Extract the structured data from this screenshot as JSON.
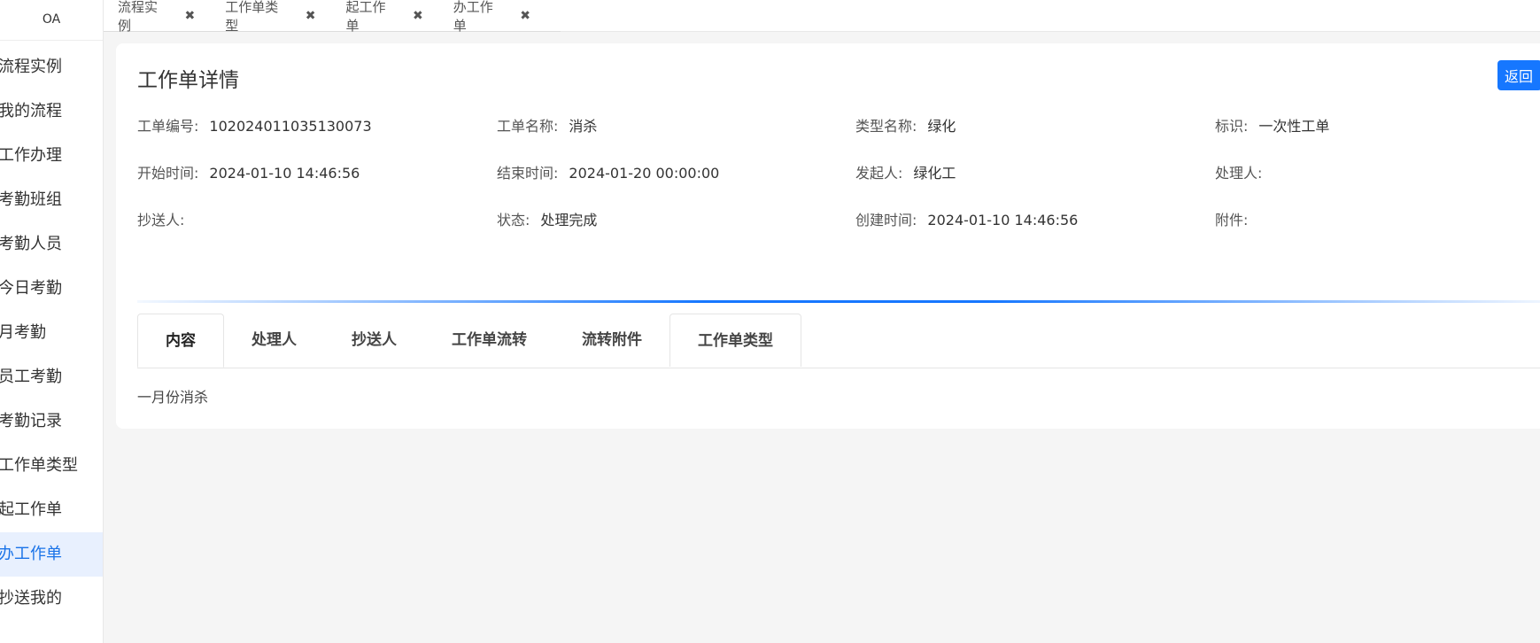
{
  "sidebar": {
    "logo": "OA",
    "items": [
      {
        "label": "流程实例"
      },
      {
        "label": "我的流程"
      },
      {
        "label": "工作办理"
      },
      {
        "label": "考勤班组"
      },
      {
        "label": "考勤人员"
      },
      {
        "label": "今日考勤"
      },
      {
        "label": "月考勤"
      },
      {
        "label": "员工考勤"
      },
      {
        "label": "考勤记录"
      },
      {
        "label": "工作单类型"
      },
      {
        "label": "起工作单"
      },
      {
        "label": "办工作单"
      },
      {
        "label": "抄送我的"
      }
    ],
    "active_index": 11
  },
  "tabs": [
    {
      "label": "流程实例",
      "close": "✖"
    },
    {
      "label": "工作单类型",
      "close": "✖"
    },
    {
      "label": "起工作单",
      "close": "✖"
    },
    {
      "label": "办工作单",
      "close": "✖"
    }
  ],
  "detail": {
    "title": "工作单详情",
    "back_label": "返回",
    "fields": {
      "number": {
        "label": "工单编号:",
        "value": "102024011035130073"
      },
      "name": {
        "label": "工单名称:",
        "value": "消杀"
      },
      "type": {
        "label": "类型名称:",
        "value": "绿化"
      },
      "flag": {
        "label": "标识:",
        "value": "一次性工单"
      },
      "start": {
        "label": "开始时间:",
        "value": "2024-01-10 14:46:56"
      },
      "end": {
        "label": "结束时间:",
        "value": "2024-01-20 00:00:00"
      },
      "initiator": {
        "label": "发起人:",
        "value": "绿化工"
      },
      "handler": {
        "label": "处理人:",
        "value": ""
      },
      "cc": {
        "label": "抄送人:",
        "value": ""
      },
      "status": {
        "label": "状态:",
        "value": "处理完成"
      },
      "created": {
        "label": "创建时间:",
        "value": "2024-01-10 14:46:56"
      },
      "attachment": {
        "label": "附件:",
        "value": ""
      }
    },
    "tabs": [
      {
        "label": "内容"
      },
      {
        "label": "处理人"
      },
      {
        "label": "抄送人"
      },
      {
        "label": "工作单流转"
      },
      {
        "label": "流转附件"
      },
      {
        "label": "工作单类型"
      }
    ],
    "content": "一月份消杀"
  },
  "colors": {
    "accent": "#1677ff",
    "active_bg": "#e8f0fe"
  }
}
